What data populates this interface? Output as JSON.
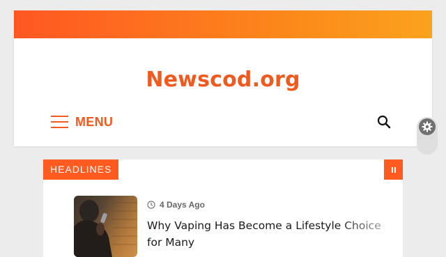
{
  "header": {
    "site_title": "Newscod.org",
    "menu_label": "MENU",
    "accent_color": "#f05a1e",
    "icons": {
      "menu": "hamburger-icon",
      "search": "search-icon",
      "settings": "gear-icon"
    }
  },
  "ticker": {
    "label": "HEADLINES",
    "pause_icon": "pause-icon",
    "items": [
      {
        "date": "4 Days Ago",
        "title": "Why Vaping Has Become a Lifestyle Choice for Many",
        "icon": "clock-icon"
      }
    ]
  }
}
